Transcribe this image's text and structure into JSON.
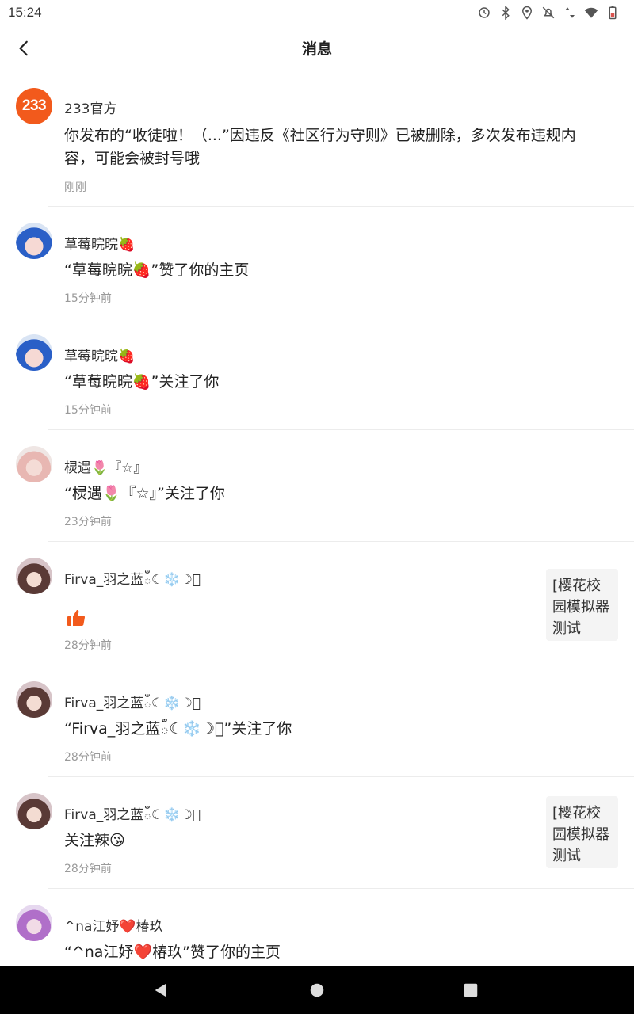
{
  "status_bar": {
    "time": "15:24",
    "icons": [
      "sync-icon",
      "bluetooth-icon",
      "location-icon",
      "notifications-off-icon",
      "data-arrows-icon",
      "wifi-icon",
      "battery-icon"
    ]
  },
  "header": {
    "title": "消息",
    "back_icon": "back-arrow-icon"
  },
  "messages": [
    {
      "name": "233官方",
      "avatar_text": "233",
      "content_line1": "你发布的“收徒啦！（...”因违反《社区行为守则》已被删除，多次发布违规内",
      "content_line2": "容，可能会被封号哦",
      "time": "刚刚"
    },
    {
      "name": "草莓晥晥🍓",
      "content": "“草莓晥晥🍓”赞了你的主页",
      "time": "15分钟前"
    },
    {
      "name": "草莓晥晥🍓",
      "content": "“草莓晥晥🍓”关注了你",
      "time": "15分钟前"
    },
    {
      "name": "棂遇🌷『☆』",
      "content": "“棂遇🌷『☆』”关注了你",
      "time": "23分钟前"
    },
    {
      "name": "Firva_羽之蓝ఀ☾❄️☽ఀ",
      "content_icon": "thumbs-up-icon",
      "time": "28分钟前",
      "tag": "[樱花校园模拟器测试版]..."
    },
    {
      "name": "Firva_羽之蓝ఀ☾❄️☽ఀ",
      "content": "“Firva_羽之蓝ఀ☾❄️☽ఀ”关注了你",
      "time": "28分钟前"
    },
    {
      "name": "Firva_羽之蓝ఀ☾❄️☽ఀ",
      "content": "关注辣😘",
      "time": "28分钟前",
      "tag": "[樱花校园模拟器测试版]..."
    },
    {
      "name": "^na江妤❤️椿玖",
      "content": "“^na江妤❤️椿玖”赞了你的主页"
    }
  ],
  "nav_bar": {
    "icons": [
      "nav-back-icon",
      "nav-home-icon",
      "nav-recents-icon"
    ]
  },
  "colors": {
    "accent": "#f25a1c",
    "time_text": "#9a9a9a",
    "divider": "#ececec",
    "tag_bg": "#f4f4f4"
  }
}
